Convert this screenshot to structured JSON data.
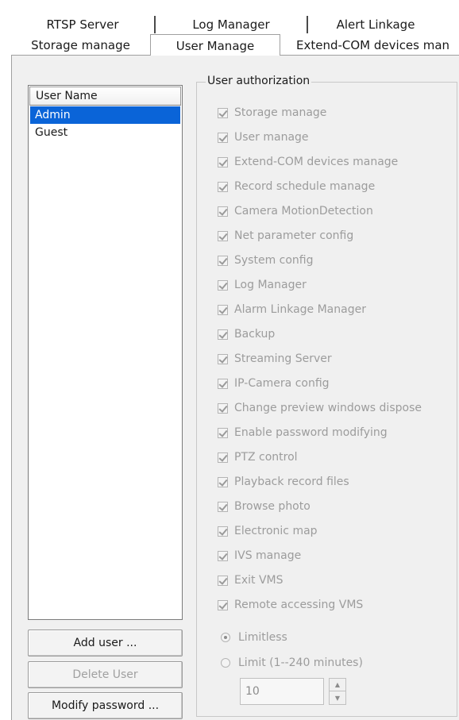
{
  "tabs": {
    "back_row": [
      "RTSP Server",
      "Log Manager",
      "Alert Linkage"
    ],
    "front_row": [
      "Storage manage",
      "User Manage",
      "Extend-COM devices man"
    ],
    "active": "User Manage"
  },
  "user_list": {
    "header": "User Name",
    "users": [
      "Admin",
      "Guest"
    ],
    "selected": "Admin"
  },
  "buttons": {
    "add_user": "Add user ...",
    "delete_user": "Delete User",
    "modify_password": "Modify password ..."
  },
  "authorization": {
    "title": "User authorization",
    "permissions": [
      "Storage manage",
      "User manage",
      "Extend-COM devices manage",
      "Record schedule manage",
      "Camera  MotionDetection",
      "Net parameter config",
      "System config",
      "Log Manager",
      "Alarm Linkage Manager",
      "Backup",
      "Streaming Server",
      "IP-Camera config",
      "Change preview windows dispose",
      "Enable password modifying",
      "PTZ control",
      "Playback record files",
      "Browse photo",
      "Electronic map",
      "IVS manage",
      "Exit VMS",
      "Remote accessing VMS"
    ],
    "all_checked": true,
    "time_limit": {
      "options": [
        "Limitless",
        "Limit (1--240 minutes)"
      ],
      "selected": "Limitless",
      "value": "10"
    }
  }
}
